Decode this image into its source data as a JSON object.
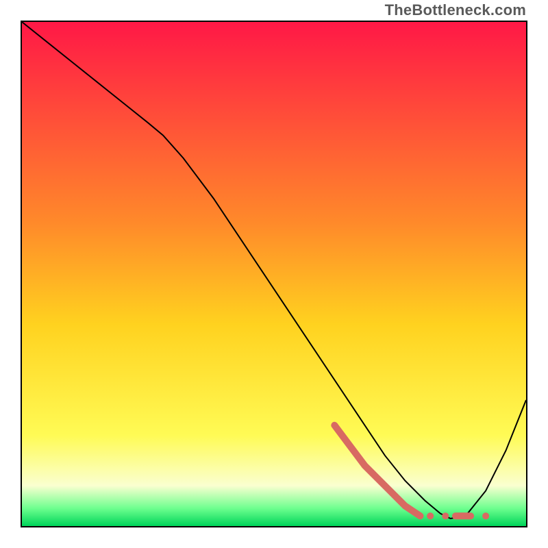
{
  "watermark": "TheBottleneck.com",
  "chart_data": {
    "type": "line",
    "title": "",
    "xlabel": "",
    "ylabel": "",
    "xlim": [
      0,
      100
    ],
    "ylim": [
      0,
      100
    ],
    "grid": false,
    "legend": false,
    "gradient_stops": [
      {
        "offset": 0,
        "color": "#ff1846"
      },
      {
        "offset": 0.4,
        "color": "#ff8a2a"
      },
      {
        "offset": 0.6,
        "color": "#ffd21f"
      },
      {
        "offset": 0.82,
        "color": "#fffb55"
      },
      {
        "offset": 0.92,
        "color": "#faffd0"
      },
      {
        "offset": 0.965,
        "color": "#6dff8e"
      },
      {
        "offset": 1.0,
        "color": "#00d45a"
      }
    ],
    "series": [
      {
        "name": "black-curve",
        "color": "#000000",
        "stroke_width": 2,
        "x": [
          0,
          5,
          10,
          15,
          20,
          25,
          28,
          32,
          38,
          44,
          50,
          56,
          62,
          68,
          72,
          76,
          80,
          83,
          85,
          88,
          92,
          96,
          100
        ],
        "values": [
          100,
          96,
          92,
          88,
          84,
          80,
          77.5,
          73,
          65,
          56,
          47,
          38,
          29,
          20,
          14,
          9,
          5,
          2.5,
          1.5,
          2,
          7,
          15,
          25
        ]
      },
      {
        "name": "red-highlight",
        "color": "#d86a62",
        "stroke_width": 10,
        "linecap": "round",
        "x": [
          62,
          68,
          72,
          76,
          79
        ],
        "values": [
          20,
          12,
          8,
          4,
          2
        ]
      }
    ],
    "markers": [
      {
        "name": "red-dot-1",
        "x": 81,
        "y": 2,
        "r": 5,
        "color": "#d86a62"
      },
      {
        "name": "red-dot-2",
        "x": 84,
        "y": 2,
        "r": 5,
        "color": "#d86a62"
      },
      {
        "name": "red-dash",
        "type": "segment",
        "x1": 86,
        "y1": 2,
        "x2": 89,
        "y2": 2,
        "stroke_width": 10,
        "color": "#d86a62"
      },
      {
        "name": "red-dot-3",
        "x": 92,
        "y": 2,
        "r": 5,
        "color": "#d86a62"
      }
    ]
  }
}
